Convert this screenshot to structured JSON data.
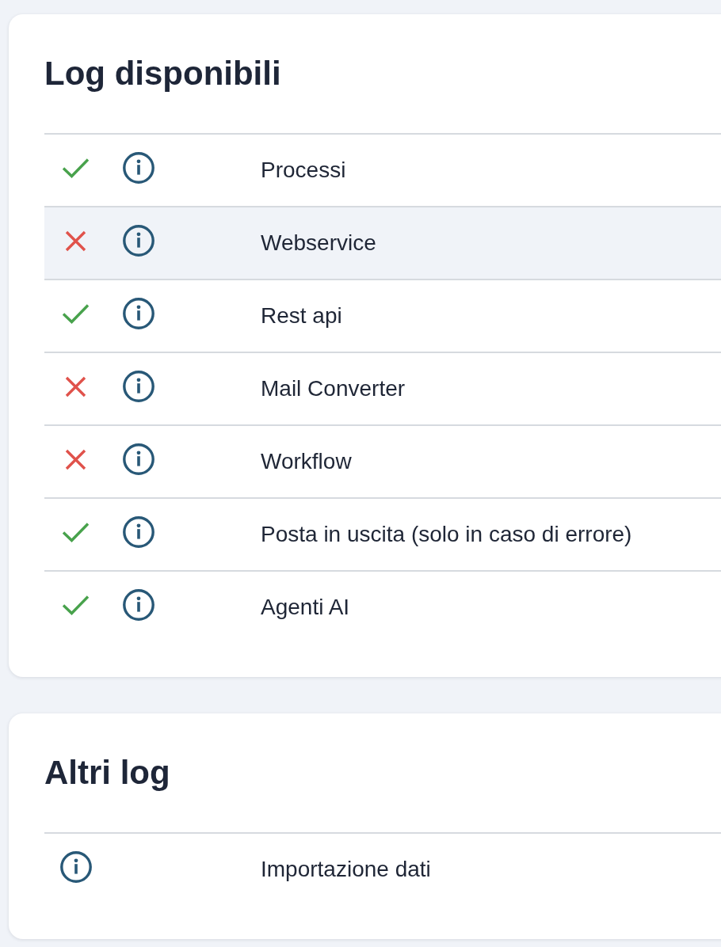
{
  "sections": [
    {
      "kind": "status_list",
      "title": "Log disponibili",
      "rows": [
        {
          "name": "Processi",
          "enabled": true,
          "selected": false
        },
        {
          "name": "Webservice",
          "enabled": false,
          "selected": true
        },
        {
          "name": "Rest api",
          "enabled": true,
          "selected": false
        },
        {
          "name": "Mail Converter",
          "enabled": false,
          "selected": false
        },
        {
          "name": "Workflow",
          "enabled": false,
          "selected": false
        },
        {
          "name": "Posta in uscita (solo in caso di errore)",
          "enabled": true,
          "selected": false
        },
        {
          "name": "Agenti AI",
          "enabled": true,
          "selected": false
        }
      ]
    },
    {
      "kind": "plain_list",
      "title": "Altri log",
      "rows": [
        {
          "name": "Importazione dati",
          "selected": false
        }
      ]
    }
  ]
}
